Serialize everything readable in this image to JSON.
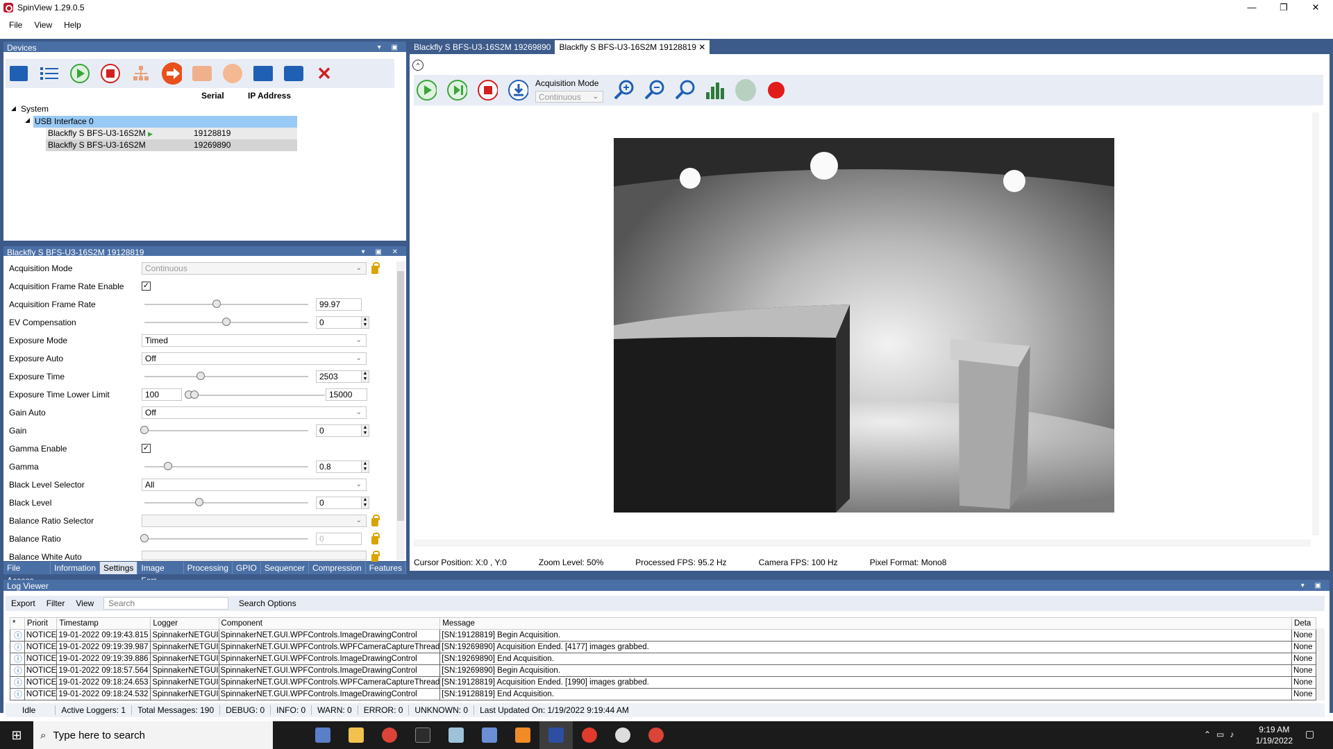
{
  "window": {
    "title": "SpinView 1.29.0.5"
  },
  "menu": [
    "File",
    "View",
    "Help"
  ],
  "devices": {
    "panel_title": "Devices",
    "columns": {
      "serial": "Serial",
      "ip": "IP Address"
    },
    "tree": {
      "system": "System",
      "interface": "USB Interface 0",
      "cameras": [
        {
          "name": "Blackfly S BFS-U3-16S2M",
          "serial": "19128819"
        },
        {
          "name": "Blackfly S BFS-U3-16S2M",
          "serial": "19269890"
        }
      ]
    }
  },
  "props": {
    "panel_title": "Blackfly S BFS-U3-16S2M 19128819",
    "rows": [
      {
        "label": "Acquisition Mode",
        "value": "Continuous"
      },
      {
        "label": "Acquisition Frame Rate Enable",
        "value": "✓"
      },
      {
        "label": "Acquisition Frame Rate",
        "value": "99.97"
      },
      {
        "label": "EV Compensation",
        "value": "0"
      },
      {
        "label": "Exposure Mode",
        "value": "Timed"
      },
      {
        "label": "Exposure Auto",
        "value": "Off"
      },
      {
        "label": "Exposure Time",
        "value": "2503"
      },
      {
        "label": "Exposure Time Lower Limit",
        "value": "100",
        "value2": "15000"
      },
      {
        "label": "Gain Auto",
        "value": "Off"
      },
      {
        "label": "Gain",
        "value": "0"
      },
      {
        "label": "Gamma Enable",
        "value": "✓"
      },
      {
        "label": "Gamma",
        "value": "0.8"
      },
      {
        "label": "Black Level Selector",
        "value": "All"
      },
      {
        "label": "Black Level",
        "value": "0"
      },
      {
        "label": "Balance Ratio Selector",
        "value": ""
      },
      {
        "label": "Balance Ratio",
        "value": "0"
      },
      {
        "label": "Balance White Auto",
        "value": ""
      }
    ],
    "tabs": [
      "File Access",
      "Information",
      "Settings",
      "Image Forr",
      "Processing",
      "GPIO",
      "Sequencer",
      "Compression",
      "Features"
    ]
  },
  "viewer": {
    "tabs": [
      "Blackfly S BFS-U3-16S2M 19269890",
      "Blackfly S BFS-U3-16S2M 19128819"
    ],
    "acq_mode_label": "Acquisition Mode",
    "acq_mode_value": "Continuous",
    "status": {
      "cursor": "Cursor Position: X:0 , Y:0",
      "zoom": "Zoom Level: 50%",
      "processed_fps": "Processed FPS: 95.2 Hz",
      "camera_fps": "Camera FPS: 100 Hz",
      "pixel_format": "Pixel Format: Mono8"
    }
  },
  "log": {
    "panel_title": "Log Viewer",
    "toolbar": {
      "export": "Export",
      "filter": "Filter",
      "view": "View",
      "search_placeholder": "Search",
      "search_options": "Search Options"
    },
    "columns": [
      "*",
      "Priorit",
      "Timestamp",
      "Logger",
      "Component",
      "Message",
      "Deta"
    ],
    "rows": [
      {
        "priority": "NOTICE",
        "timestamp": "19-01-2022 09:19:43.815",
        "logger": "SpinnakerNETGUI",
        "component": "SpinnakerNET.GUI.WPFControls.ImageDrawingControl",
        "message": "[SN:19128819] Begin Acquisition.",
        "detail": "None"
      },
      {
        "priority": "NOTICE",
        "timestamp": "19-01-2022 09:19:39.987",
        "logger": "SpinnakerNETGUI",
        "component": "SpinnakerNET.GUI.WPFControls.WPFCameraCaptureThread",
        "message": "[SN:19269890] Acquisition Ended. [4177] images grabbed.",
        "detail": "None"
      },
      {
        "priority": "NOTICE",
        "timestamp": "19-01-2022 09:19:39.886",
        "logger": "SpinnakerNETGUI",
        "component": "SpinnakerNET.GUI.WPFControls.ImageDrawingControl",
        "message": "[SN:19269890] End Acquisition.",
        "detail": "None"
      },
      {
        "priority": "NOTICE",
        "timestamp": "19-01-2022 09:18:57.564",
        "logger": "SpinnakerNETGUI",
        "component": "SpinnakerNET.GUI.WPFControls.ImageDrawingControl",
        "message": "[SN:19269890] Begin Acquisition.",
        "detail": "None"
      },
      {
        "priority": "NOTICE",
        "timestamp": "19-01-2022 09:18:24.653",
        "logger": "SpinnakerNETGUI",
        "component": "SpinnakerNET.GUI.WPFControls.WPFCameraCaptureThread",
        "message": "[SN:19128819] Acquisition Ended. [1990] images grabbed.",
        "detail": "None"
      },
      {
        "priority": "NOTICE",
        "timestamp": "19-01-2022 09:18:24.532",
        "logger": "SpinnakerNETGUI",
        "component": "SpinnakerNET.GUI.WPFControls.ImageDrawingControl",
        "message": "[SN:19128819] End Acquisition.",
        "detail": "None"
      }
    ],
    "status": {
      "state": "Idle",
      "active_loggers": "Active Loggers: 1",
      "total": "Total Messages: 190",
      "debug": "DEBUG: 0",
      "info": "INFO: 0",
      "warn": "WARN: 0",
      "error": "ERROR: 0",
      "unknown": "UNKNOWN: 0",
      "updated": "Last Updated On: 1/19/2022 9:19:44 AM"
    }
  },
  "taskbar": {
    "search_placeholder": "Type here to search",
    "time": "9:19 AM",
    "date": "1/19/2022"
  }
}
